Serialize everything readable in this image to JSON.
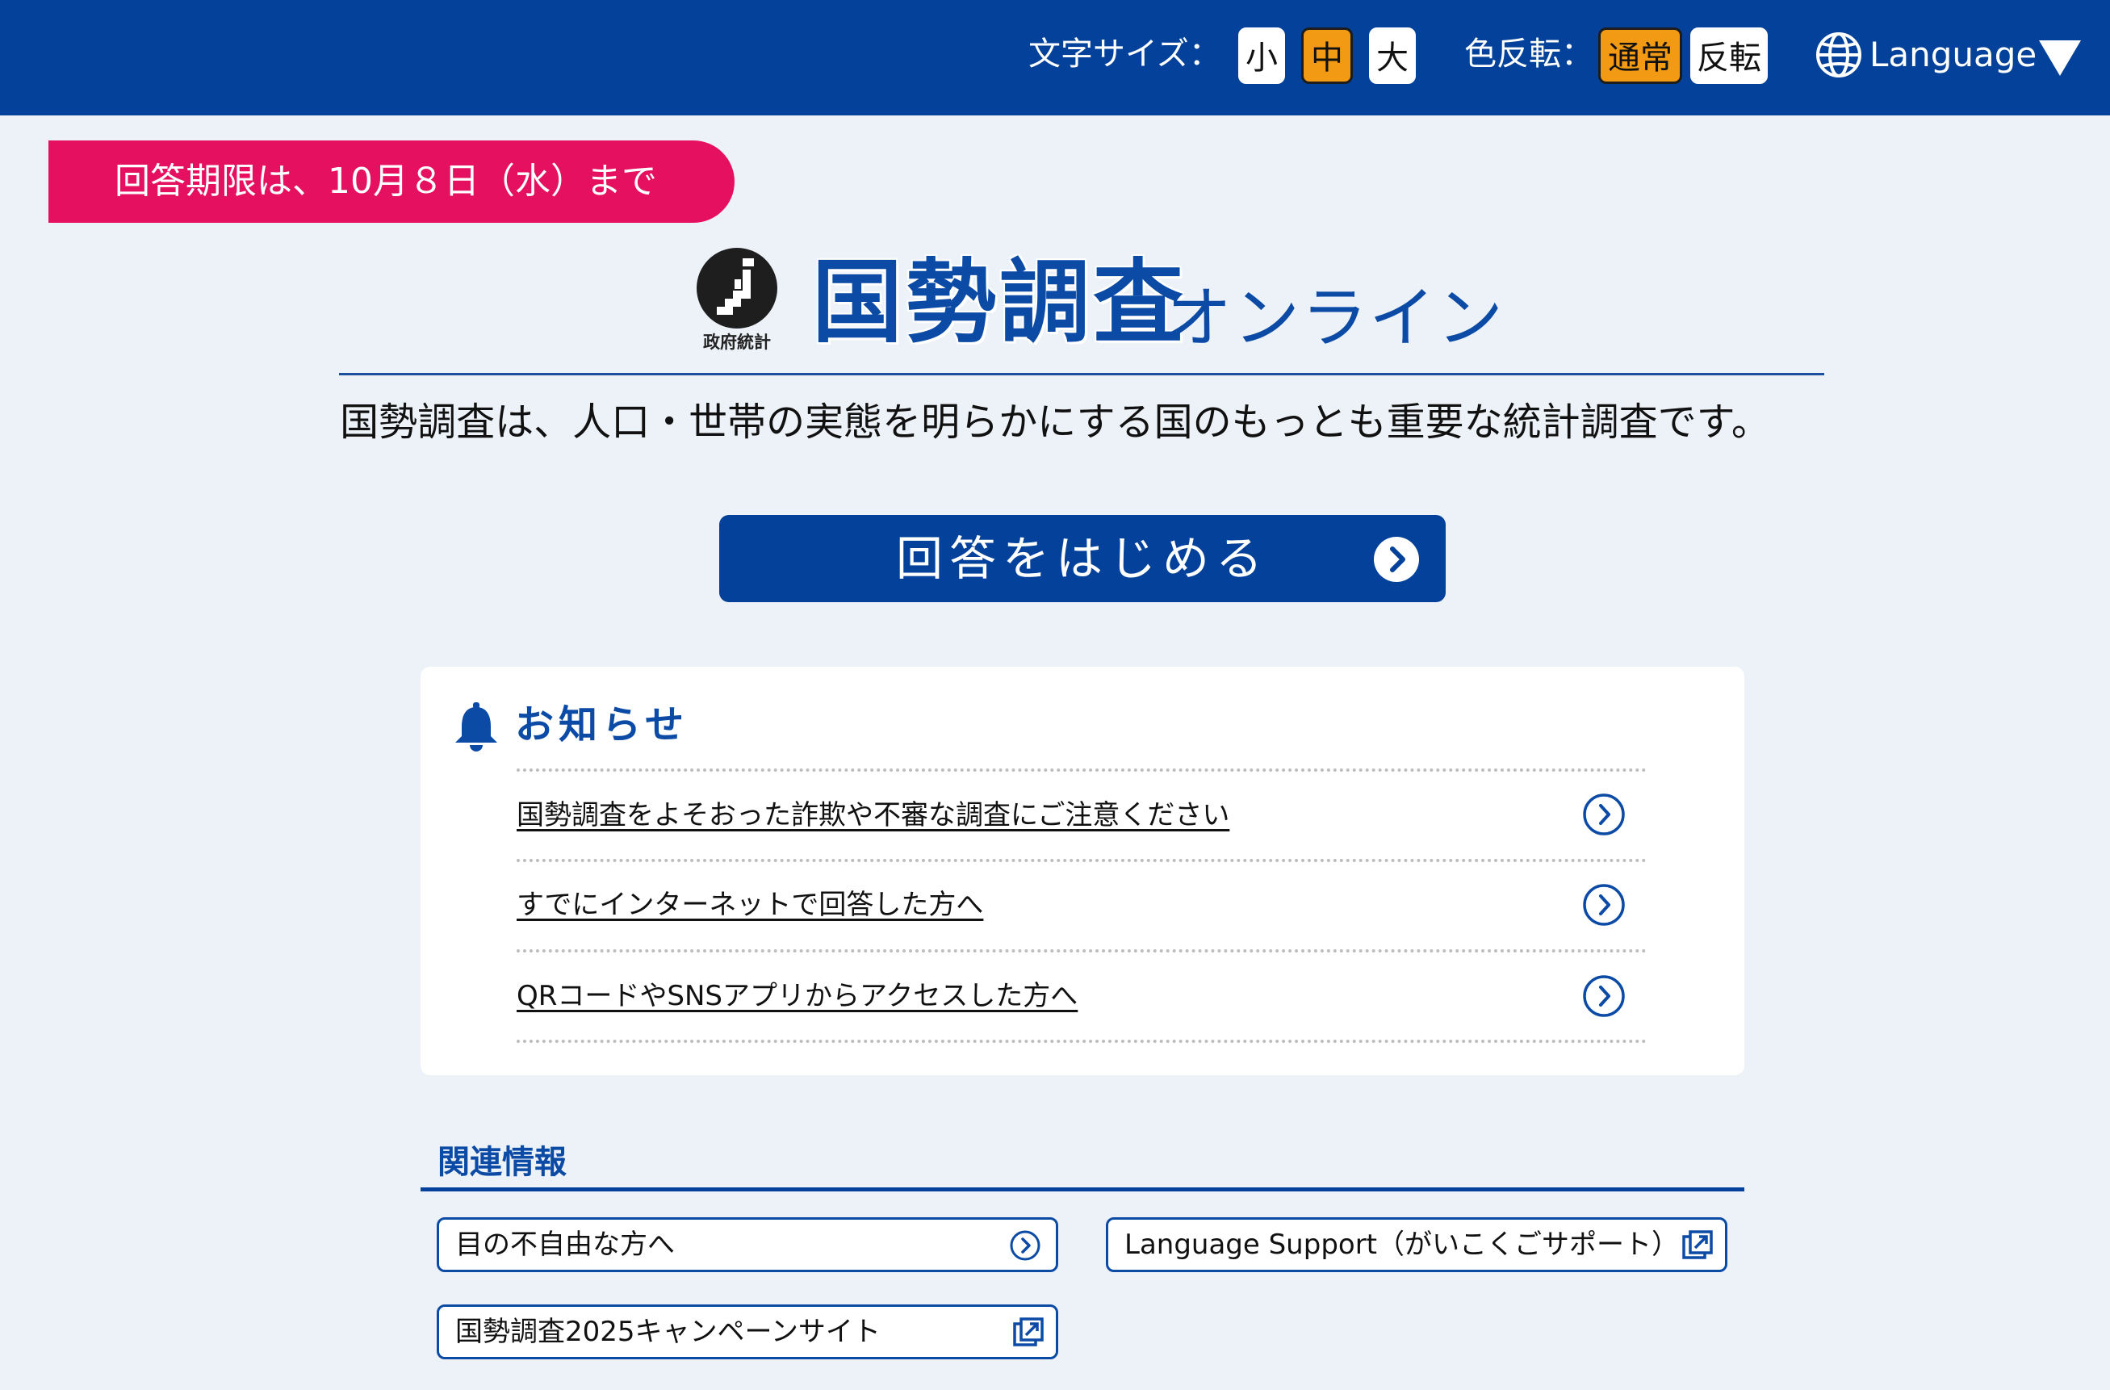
{
  "header": {
    "font_size_label": "文字サイズ：",
    "font_size_options": [
      "小",
      "中",
      "大"
    ],
    "font_size_selected": "中",
    "color_invert_label": "色反転：",
    "color_options": [
      "通常",
      "反転"
    ],
    "color_selected": "通常",
    "language_label": "Language",
    "language_icon": "globe-icon",
    "language_dropdown_icon": "triangle-down-icon"
  },
  "deadline": "回答期限は、10月８日（水）まで",
  "logo": {
    "mark_caption": "政府統計",
    "title": "国勢調査",
    "title_suffix": "オンライン"
  },
  "tagline": "国勢調査は、人口・世帯の実態を明らかにする国のもっとも重要な統計調査です。",
  "start_button": {
    "label": "回答をはじめる",
    "icon": "chevron-right-circle-icon"
  },
  "notices": {
    "heading": "お知らせ",
    "icon": "bell-icon",
    "items": [
      "国勢調査をよそおった詐欺や不審な調査にご注意ください",
      "すでにインターネットで回答した方へ",
      "QRコードやSNSアプリからアクセスした方へ"
    ]
  },
  "related": {
    "heading": "関連情報",
    "links": [
      {
        "label": "目の不自由な方へ",
        "icon": "chevron-right-circle-icon"
      },
      {
        "label": "Language Support（がいこくごサポート）",
        "icon": "external-link-icon"
      },
      {
        "label": "国勢調査2025キャンペーンサイト",
        "icon": "external-link-icon"
      }
    ]
  },
  "colors": {
    "header_bg": "#03419a",
    "page_bg": "#edf2f8",
    "accent_orange": "#f39a14",
    "deadline_pink": "#e5105f",
    "brand_blue": "#0b4aa5"
  }
}
